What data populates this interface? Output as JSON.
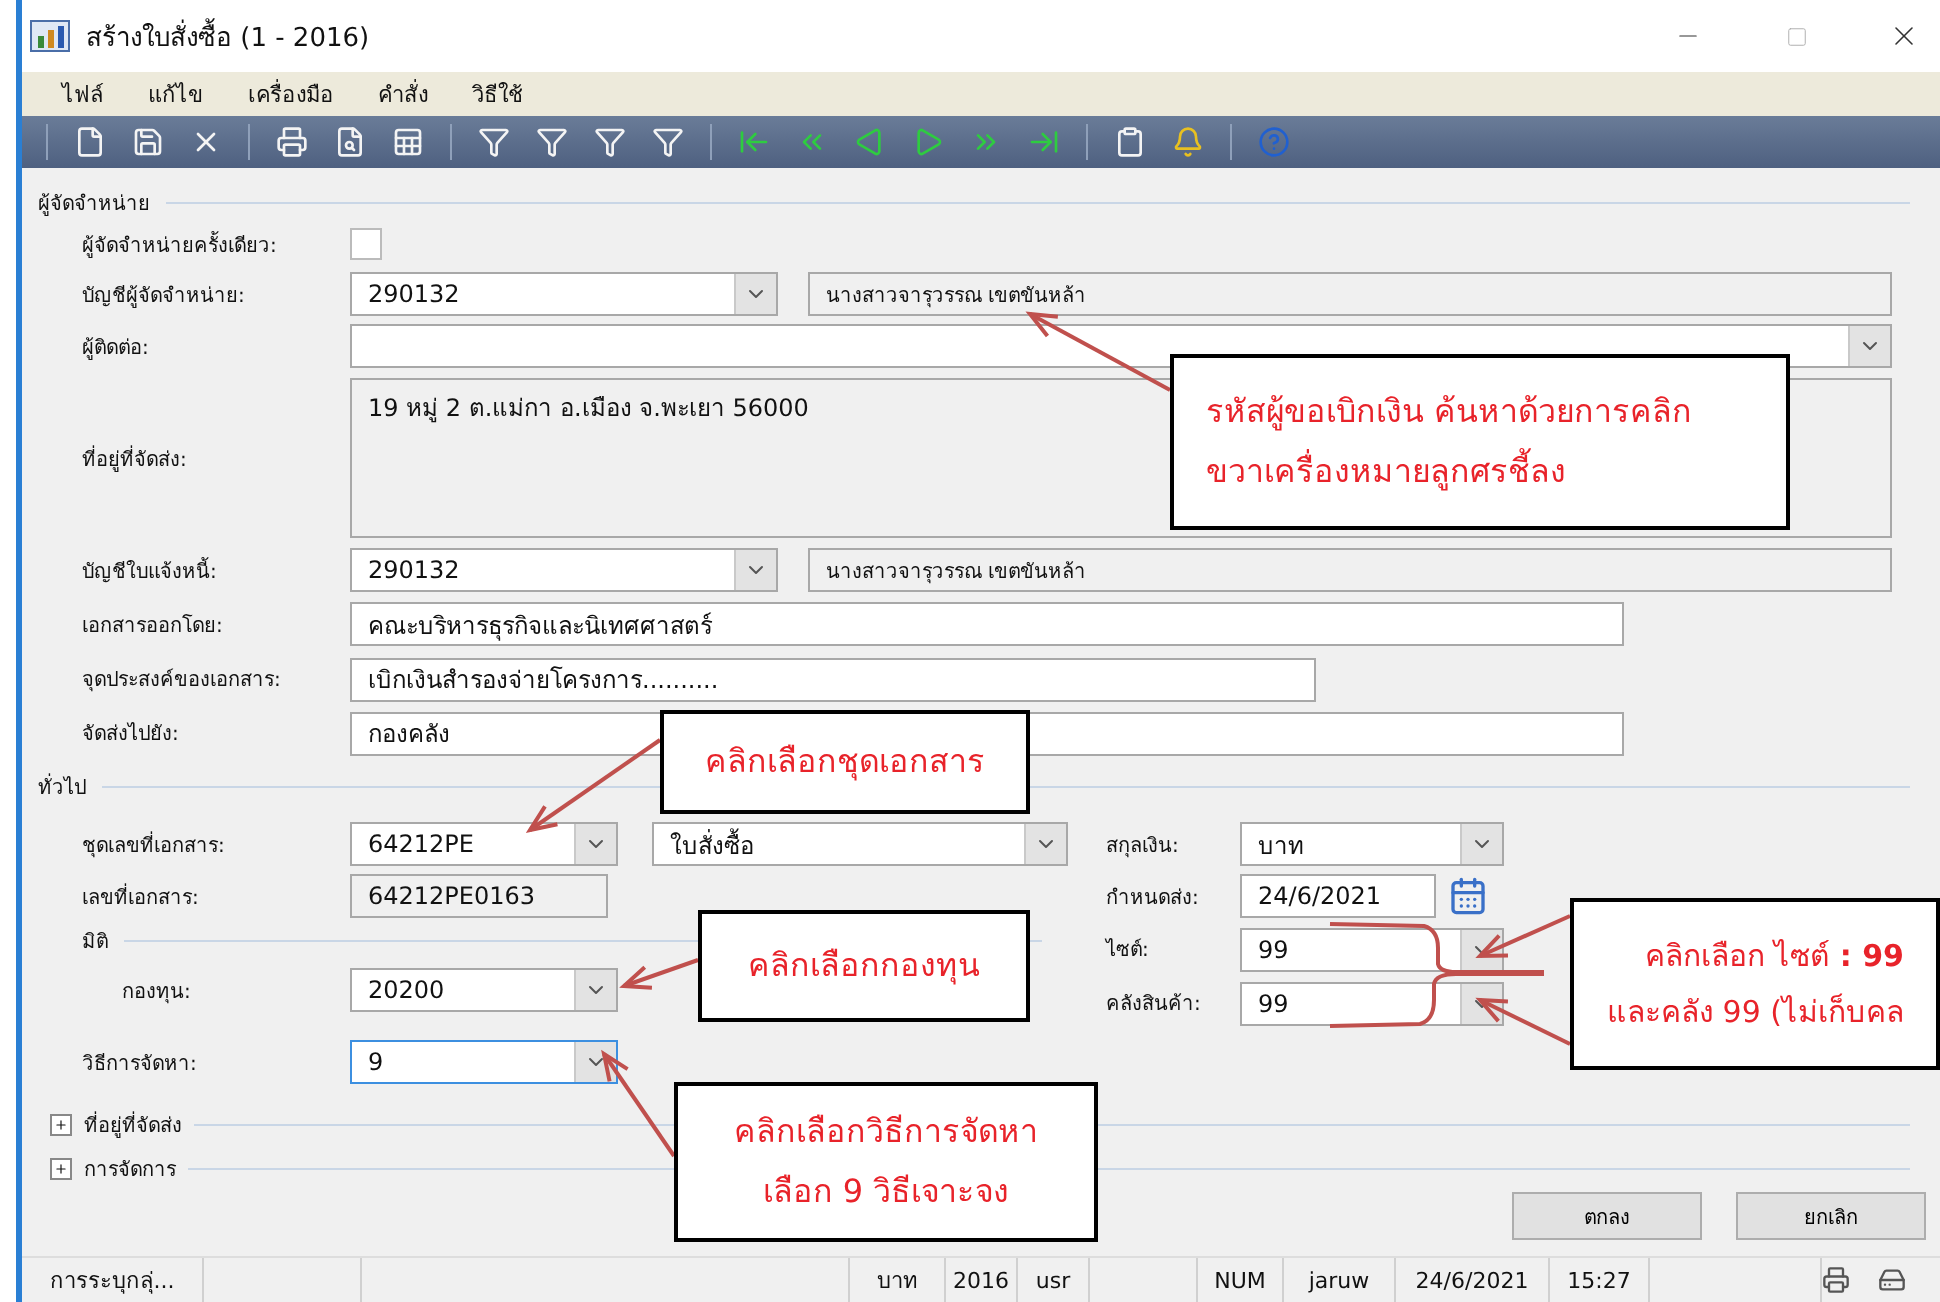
{
  "window": {
    "title": "สร้างใบสั่งซื้อ (1 - 2016)"
  },
  "menu": [
    "ไฟล์",
    "แก้ไข",
    "เครื่องมือ",
    "คำสั่ง",
    "วิธีใช้"
  ],
  "vendor_section": {
    "title": "ผู้จัดจำหน่าย",
    "one_time": {
      "label": "ผู้จัดจำหน่ายครั้งเดียว:",
      "checked": false
    },
    "vendor_account": {
      "label": "บัญชีผู้จัดจำหน่าย:",
      "value": "290132",
      "name": "นางสาวจารุวรรณ  เขตขันหล้า"
    },
    "contact": {
      "label": "ผู้ติดต่อ:"
    },
    "delivery_address": {
      "label": "ที่อยู่ที่จัดส่ง:",
      "value": "19  หมู่ 2 ต.แม่กา อ.เมือง จ.พะเยา 56000"
    },
    "invoice_account": {
      "label": "บัญชีใบแจ้งหนี้:",
      "value": "290132",
      "name": "นางสาวจารุวรรณ  เขตขันหล้า"
    },
    "issued_by": {
      "label": "เอกสารออกโดย:",
      "value": "คณะบริหารธุรกิจและนิเทศศาสตร์"
    },
    "purpose": {
      "label": "จุดประสงค์ของเอกสาร:",
      "value": "เบิกเงินสำรองจ่ายโครงการ.........."
    },
    "deliver_to": {
      "label": "จัดส่งไปยัง:",
      "value": "กองคลัง"
    }
  },
  "general_section": {
    "title": "ทั่วไป",
    "number_sequence": {
      "label": "ชุดเลขที่เอกสาร:",
      "value": "64212PE",
      "type": "ใบสั่งซื้อ"
    },
    "document_number": {
      "label": "เลขที่เอกสาร:",
      "value": "64212PE0163"
    },
    "dimension": {
      "title": "มิติ",
      "fund": {
        "label": "กองทุน:",
        "value": "20200"
      }
    },
    "procurement_method": {
      "label": "วิธีการจัดหา:",
      "value": "9",
      "focused": true
    },
    "currency": {
      "label": "สกุลเงิน:",
      "value": "บาท"
    },
    "delivery_date": {
      "label": "กำหนดส่ง:",
      "value": "24/6/2021"
    },
    "site": {
      "label": "ไซต์:",
      "value": "99"
    },
    "warehouse": {
      "label": "คลังสินค้า:",
      "value": "99"
    }
  },
  "collapsed_sections": [
    {
      "title": "ที่อยู่ที่จัดส่ง",
      "expanded": false
    },
    {
      "title": "การจัดการ",
      "expanded": false
    }
  ],
  "buttons": [
    "ตกลง",
    "ยกเลิก"
  ],
  "status_bar": [
    "การระบุกลุ่...",
    "บาท",
    "2016",
    "usr",
    "NUM",
    "jaruw",
    "24/6/2021",
    "15:27"
  ],
  "callouts": [
    {
      "lines": [
        "รหัสผู้ขอเบิกเงิน ค้นหาด้วยการคลิก",
        "ขวาเครื่องหมายลูกศรชี้ลง"
      ]
    },
    {
      "lines": [
        "คลิกเลือกชุดเอกสาร"
      ]
    },
    {
      "lines": [
        "คลิกเลือกกองทุน"
      ]
    },
    {
      "lines": [
        "คลิกเลือกวิธีการจัดหา",
        "เลือก 9 วิธีเจาะจง"
      ]
    },
    {
      "lines": [
        "คลิกเลือก ไซต์ **: 99**",
        "และคลัง 99 (ไม่เก็บคล"
      ]
    }
  ]
}
